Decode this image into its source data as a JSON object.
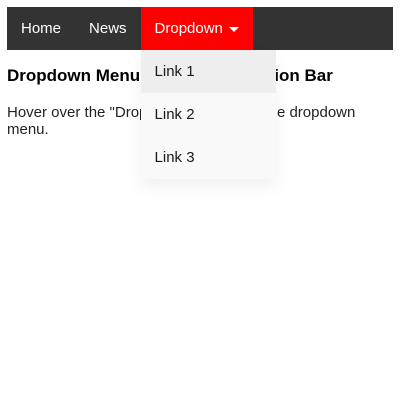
{
  "navbar": {
    "items": [
      {
        "label": "Home"
      },
      {
        "label": "News"
      }
    ],
    "dropdown": {
      "label": "Dropdown",
      "links": [
        {
          "label": "Link 1"
        },
        {
          "label": "Link 2"
        },
        {
          "label": "Link 3"
        }
      ]
    },
    "active_color": "#ff0000",
    "background_color": "#333333"
  },
  "content": {
    "title": "Dropdown Menu inside a Navigation Bar",
    "text": "Hover over the \"Dropdown\" link to see the dropdown menu."
  }
}
